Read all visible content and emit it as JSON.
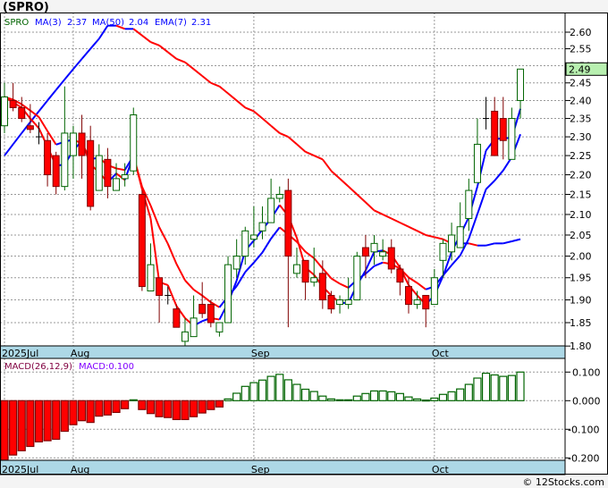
{
  "header": {
    "title": "(SPRO)",
    "footer": "© 12Stocks.com"
  },
  "legend": {
    "symbol": "SPRO",
    "ma3_label": "MA(3)",
    "ma3_value": "2.37",
    "ma50_label": "MA(50)",
    "ma50_value": "2.04",
    "ema7_label": "EMA(7)",
    "ema7_value": "2.31",
    "macd_label": "MACD(26,12,9)",
    "macd_value": "MACD:0.100"
  },
  "colors": {
    "up": "#006400",
    "down": "#ff0000",
    "rising_ma": "#0000ff",
    "falling_ma": "#ff0000",
    "axis_bar": "#add8e6",
    "last_price_bg": "#b8f0b0"
  },
  "chart_data": [
    {
      "type": "candlestick",
      "scale": "log",
      "ylim": [
        1.8,
        2.62
      ],
      "yticks": [
        "2.60",
        "2.55",
        "2.50",
        "2.45",
        "2.40",
        "2.35",
        "2.30",
        "2.25",
        "2.20",
        "2.15",
        "2.10",
        "2.05",
        "2.00",
        "1.95",
        "1.90",
        "1.85",
        "1.80"
      ],
      "xlabels": [
        {
          "label": "2025Jul",
          "index": 0
        },
        {
          "label": "Aug",
          "index": 8
        },
        {
          "label": "Sep",
          "index": 29
        },
        {
          "label": "Oct",
          "index": 50
        }
      ],
      "last_price": "2.49",
      "ohlc": [
        [
          2.33,
          2.45,
          2.31,
          2.41
        ],
        [
          2.4,
          2.45,
          2.37,
          2.38
        ],
        [
          2.38,
          2.41,
          2.34,
          2.35
        ],
        [
          2.33,
          2.39,
          2.31,
          2.32
        ],
        [
          2.3,
          2.34,
          2.28,
          2.3
        ],
        [
          2.29,
          2.31,
          2.17,
          2.2
        ],
        [
          2.25,
          2.26,
          2.15,
          2.17
        ],
        [
          2.17,
          2.44,
          2.16,
          2.31
        ],
        [
          2.25,
          2.33,
          2.19,
          2.31
        ],
        [
          2.31,
          2.36,
          2.19,
          2.25
        ],
        [
          2.29,
          2.33,
          2.11,
          2.12
        ],
        [
          2.16,
          2.28,
          2.16,
          2.25
        ],
        [
          2.24,
          2.27,
          2.14,
          2.17
        ],
        [
          2.16,
          2.23,
          2.16,
          2.19
        ],
        [
          2.19,
          2.23,
          2.17,
          2.2
        ],
        [
          2.21,
          2.38,
          2.2,
          2.36
        ],
        [
          2.15,
          2.16,
          1.92,
          1.93
        ],
        [
          1.92,
          2.03,
          1.92,
          1.98
        ],
        [
          1.95,
          1.95,
          1.85,
          1.91
        ],
        [
          1.91,
          1.93,
          1.89,
          1.91
        ],
        [
          1.88,
          1.89,
          1.84,
          1.84
        ],
        [
          1.81,
          1.86,
          1.8,
          1.83
        ],
        [
          1.82,
          1.91,
          1.82,
          1.86
        ],
        [
          1.89,
          1.94,
          1.86,
          1.87
        ],
        [
          1.89,
          1.9,
          1.84,
          1.85
        ],
        [
          1.83,
          1.85,
          1.82,
          1.85
        ],
        [
          1.85,
          2.0,
          1.85,
          1.98
        ],
        [
          1.97,
          2.04,
          1.95,
          2.0
        ],
        [
          2.0,
          2.07,
          1.98,
          2.06
        ],
        [
          2.04,
          2.12,
          2.02,
          2.05
        ],
        [
          2.06,
          2.12,
          2.04,
          2.08
        ],
        [
          2.08,
          2.19,
          2.08,
          2.14
        ],
        [
          2.14,
          2.17,
          2.13,
          2.15
        ],
        [
          2.16,
          2.19,
          1.84,
          2.0
        ],
        [
          1.96,
          2.02,
          1.95,
          1.98
        ],
        [
          1.99,
          1.99,
          1.9,
          1.94
        ],
        [
          1.94,
          2.02,
          1.93,
          1.95
        ],
        [
          1.96,
          1.99,
          1.88,
          1.9
        ],
        [
          1.91,
          1.92,
          1.87,
          1.88
        ],
        [
          1.89,
          1.91,
          1.87,
          1.9
        ],
        [
          1.89,
          1.95,
          1.88,
          1.9
        ],
        [
          1.9,
          2.01,
          1.9,
          2.0
        ],
        [
          2.02,
          2.05,
          1.95,
          2.0
        ],
        [
          2.01,
          2.05,
          1.98,
          2.03
        ],
        [
          2.0,
          2.04,
          1.99,
          2.01
        ],
        [
          2.02,
          2.04,
          1.96,
          1.97
        ],
        [
          1.97,
          1.98,
          1.91,
          1.94
        ],
        [
          1.93,
          1.95,
          1.87,
          1.89
        ],
        [
          1.89,
          1.92,
          1.88,
          1.9
        ],
        [
          1.91,
          1.91,
          1.84,
          1.88
        ],
        [
          1.89,
          1.97,
          1.89,
          1.95
        ],
        [
          1.99,
          2.04,
          1.95,
          2.03
        ],
        [
          2.01,
          2.08,
          1.99,
          2.05
        ],
        [
          2.02,
          2.13,
          2.02,
          2.07
        ],
        [
          2.09,
          2.19,
          2.06,
          2.16
        ],
        [
          2.18,
          2.35,
          2.18,
          2.28
        ],
        [
          2.35,
          2.41,
          2.32,
          2.35
        ],
        [
          2.37,
          2.41,
          2.25,
          2.25
        ],
        [
          2.35,
          2.41,
          2.24,
          2.29
        ],
        [
          2.24,
          2.38,
          2.24,
          2.35
        ],
        [
          2.4,
          2.49,
          2.35,
          2.49
        ]
      ],
      "ma50": [
        2.25,
        2.28,
        2.31,
        2.34,
        2.37,
        2.4,
        2.43,
        2.46,
        2.49,
        2.52,
        2.55,
        2.58,
        2.62,
        2.62,
        2.61,
        2.61,
        2.59,
        2.57,
        2.56,
        2.54,
        2.52,
        2.51,
        2.49,
        2.47,
        2.45,
        2.44,
        2.42,
        2.4,
        2.38,
        2.37,
        2.35,
        2.33,
        2.31,
        2.3,
        2.28,
        2.26,
        2.25,
        2.24,
        2.21,
        2.19,
        2.17,
        2.15,
        2.13,
        2.11,
        2.1,
        2.09,
        2.08,
        2.07,
        2.06,
        2.05,
        2.045,
        2.04,
        2.03,
        2.03,
        2.03,
        2.025,
        2.025,
        2.03,
        2.03,
        2.035,
        2.04
      ]
    },
    {
      "type": "bar",
      "name": "MACD(26,12,9)",
      "ylim": [
        -0.22,
        0.12
      ],
      "yticks": [
        "0.100",
        "0.000",
        "-0.100",
        "-0.200"
      ],
      "values": [
        -0.208,
        -0.19,
        -0.175,
        -0.16,
        -0.144,
        -0.14,
        -0.135,
        -0.107,
        -0.084,
        -0.07,
        -0.076,
        -0.054,
        -0.05,
        -0.041,
        -0.028,
        0.003,
        -0.031,
        -0.045,
        -0.056,
        -0.059,
        -0.066,
        -0.066,
        -0.056,
        -0.043,
        -0.031,
        -0.022,
        0.006,
        0.026,
        0.05,
        0.063,
        0.072,
        0.085,
        0.092,
        0.073,
        0.057,
        0.04,
        0.032,
        0.016,
        0.006,
        0.003,
        0.003,
        0.016,
        0.025,
        0.034,
        0.034,
        0.031,
        0.025,
        0.013,
        0.006,
        0.002,
        0.009,
        0.022,
        0.031,
        0.041,
        0.057,
        0.079,
        0.096,
        0.09,
        0.085,
        0.088,
        0.1
      ]
    }
  ]
}
